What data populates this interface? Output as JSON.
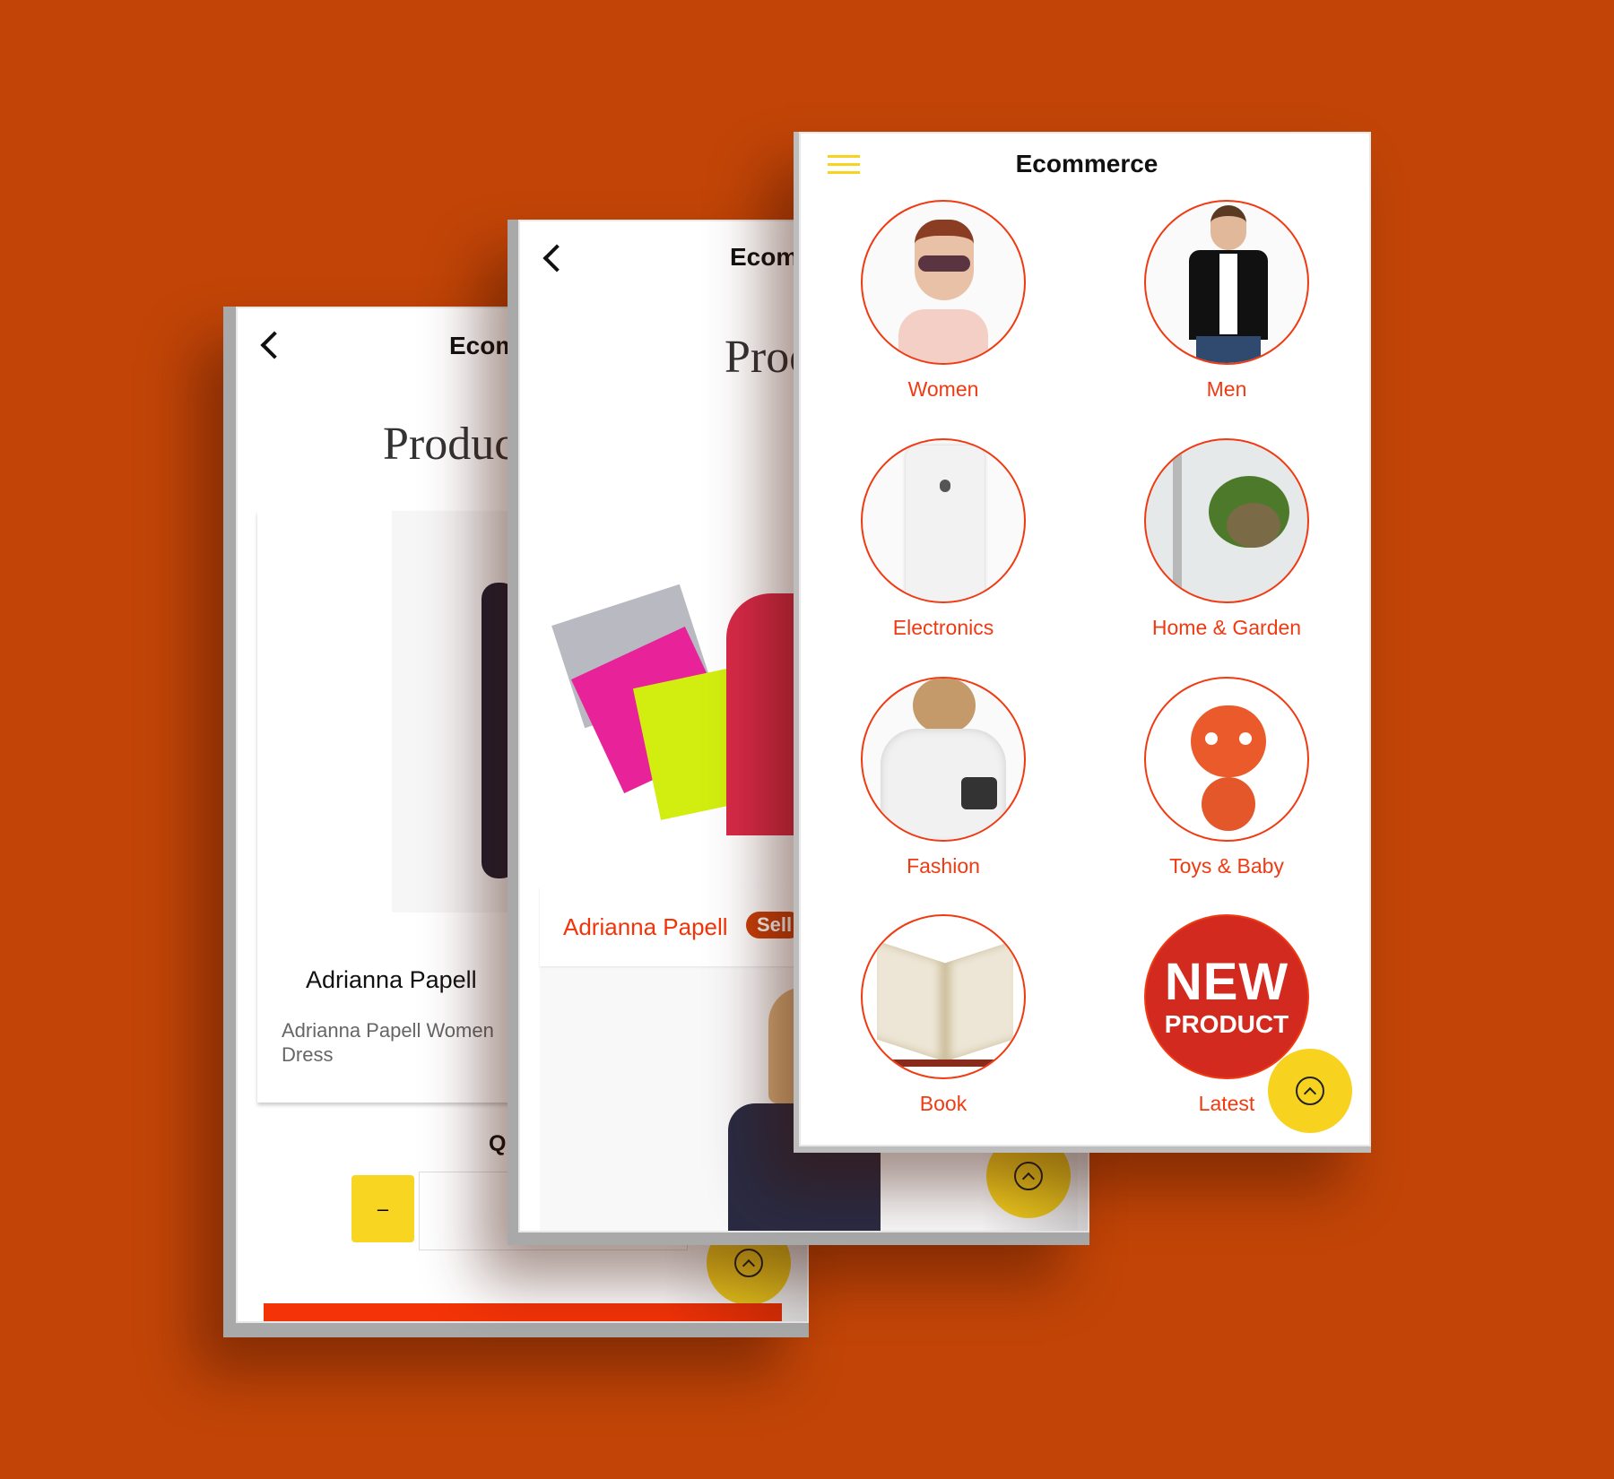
{
  "colors": {
    "background": "#c24507",
    "accent": "#f03a12",
    "fab": "#f7d21f",
    "badge": "#c9400a"
  },
  "back_screen": {
    "header_title": "Ecommerce",
    "page_heading": "Products",
    "product_name": "Adrianna Papell",
    "desc_line1": "Adrianna Papell Women",
    "desc_line2": "Dress",
    "quantity_label": "Quantity",
    "minus_label": "–",
    "back_icon": "chevron-left-icon",
    "fab_icon": "arrow-up-circle-icon"
  },
  "middle_screen": {
    "header_title": "Ecommerce",
    "page_heading": "Products",
    "product_name": "Adrianna Papell",
    "badge": "Sell",
    "back_icon": "chevron-left-icon",
    "fab_icon": "arrow-up-circle-icon"
  },
  "front_screen": {
    "header_title": "Ecommerce",
    "menu_icon": "hamburger-menu-icon",
    "fab_icon": "arrow-up-circle-icon",
    "categories": [
      {
        "label": "Women"
      },
      {
        "label": "Men"
      },
      {
        "label": "Electronics"
      },
      {
        "label": "Home & Garden"
      },
      {
        "label": "Fashion"
      },
      {
        "label": "Toys & Baby"
      },
      {
        "label": "Book"
      },
      {
        "label": "Latest"
      }
    ],
    "latest_logo_text": "NEW PRODUCT"
  }
}
